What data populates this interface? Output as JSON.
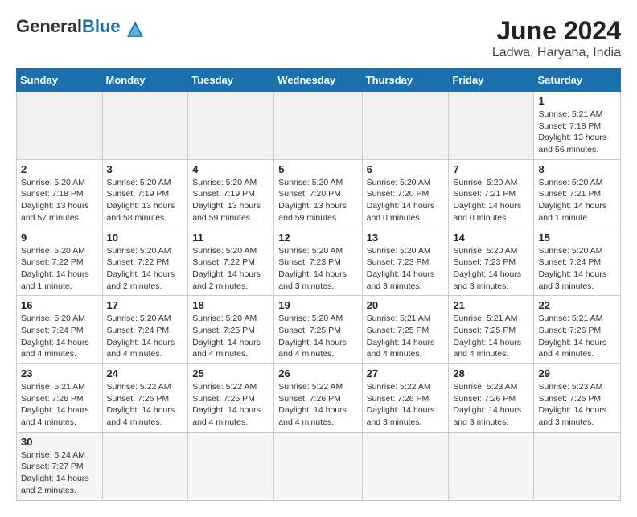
{
  "header": {
    "logo_general": "General",
    "logo_blue": "Blue",
    "month_year": "June 2024",
    "location": "Ladwa, Haryana, India"
  },
  "weekdays": [
    "Sunday",
    "Monday",
    "Tuesday",
    "Wednesday",
    "Thursday",
    "Friday",
    "Saturday"
  ],
  "days": {
    "d1": {
      "num": "1",
      "sunrise": "Sunrise: 5:21 AM",
      "sunset": "Sunset: 7:18 PM",
      "daylight": "Daylight: 13 hours and 56 minutes."
    },
    "d2": {
      "num": "2",
      "sunrise": "Sunrise: 5:20 AM",
      "sunset": "Sunset: 7:18 PM",
      "daylight": "Daylight: 13 hours and 57 minutes."
    },
    "d3": {
      "num": "3",
      "sunrise": "Sunrise: 5:20 AM",
      "sunset": "Sunset: 7:19 PM",
      "daylight": "Daylight: 13 hours and 58 minutes."
    },
    "d4": {
      "num": "4",
      "sunrise": "Sunrise: 5:20 AM",
      "sunset": "Sunset: 7:19 PM",
      "daylight": "Daylight: 13 hours and 59 minutes."
    },
    "d5": {
      "num": "5",
      "sunrise": "Sunrise: 5:20 AM",
      "sunset": "Sunset: 7:20 PM",
      "daylight": "Daylight: 13 hours and 59 minutes."
    },
    "d6": {
      "num": "6",
      "sunrise": "Sunrise: 5:20 AM",
      "sunset": "Sunset: 7:20 PM",
      "daylight": "Daylight: 14 hours and 0 minutes."
    },
    "d7": {
      "num": "7",
      "sunrise": "Sunrise: 5:20 AM",
      "sunset": "Sunset: 7:21 PM",
      "daylight": "Daylight: 14 hours and 0 minutes."
    },
    "d8": {
      "num": "8",
      "sunrise": "Sunrise: 5:20 AM",
      "sunset": "Sunset: 7:21 PM",
      "daylight": "Daylight: 14 hours and 1 minute."
    },
    "d9": {
      "num": "9",
      "sunrise": "Sunrise: 5:20 AM",
      "sunset": "Sunset: 7:22 PM",
      "daylight": "Daylight: 14 hours and 1 minute."
    },
    "d10": {
      "num": "10",
      "sunrise": "Sunrise: 5:20 AM",
      "sunset": "Sunset: 7:22 PM",
      "daylight": "Daylight: 14 hours and 2 minutes."
    },
    "d11": {
      "num": "11",
      "sunrise": "Sunrise: 5:20 AM",
      "sunset": "Sunset: 7:22 PM",
      "daylight": "Daylight: 14 hours and 2 minutes."
    },
    "d12": {
      "num": "12",
      "sunrise": "Sunrise: 5:20 AM",
      "sunset": "Sunset: 7:23 PM",
      "daylight": "Daylight: 14 hours and 3 minutes."
    },
    "d13": {
      "num": "13",
      "sunrise": "Sunrise: 5:20 AM",
      "sunset": "Sunset: 7:23 PM",
      "daylight": "Daylight: 14 hours and 3 minutes."
    },
    "d14": {
      "num": "14",
      "sunrise": "Sunrise: 5:20 AM",
      "sunset": "Sunset: 7:23 PM",
      "daylight": "Daylight: 14 hours and 3 minutes."
    },
    "d15": {
      "num": "15",
      "sunrise": "Sunrise: 5:20 AM",
      "sunset": "Sunset: 7:24 PM",
      "daylight": "Daylight: 14 hours and 3 minutes."
    },
    "d16": {
      "num": "16",
      "sunrise": "Sunrise: 5:20 AM",
      "sunset": "Sunset: 7:24 PM",
      "daylight": "Daylight: 14 hours and 4 minutes."
    },
    "d17": {
      "num": "17",
      "sunrise": "Sunrise: 5:20 AM",
      "sunset": "Sunset: 7:24 PM",
      "daylight": "Daylight: 14 hours and 4 minutes."
    },
    "d18": {
      "num": "18",
      "sunrise": "Sunrise: 5:20 AM",
      "sunset": "Sunset: 7:25 PM",
      "daylight": "Daylight: 14 hours and 4 minutes."
    },
    "d19": {
      "num": "19",
      "sunrise": "Sunrise: 5:20 AM",
      "sunset": "Sunset: 7:25 PM",
      "daylight": "Daylight: 14 hours and 4 minutes."
    },
    "d20": {
      "num": "20",
      "sunrise": "Sunrise: 5:21 AM",
      "sunset": "Sunset: 7:25 PM",
      "daylight": "Daylight: 14 hours and 4 minutes."
    },
    "d21": {
      "num": "21",
      "sunrise": "Sunrise: 5:21 AM",
      "sunset": "Sunset: 7:25 PM",
      "daylight": "Daylight: 14 hours and 4 minutes."
    },
    "d22": {
      "num": "22",
      "sunrise": "Sunrise: 5:21 AM",
      "sunset": "Sunset: 7:26 PM",
      "daylight": "Daylight: 14 hours and 4 minutes."
    },
    "d23": {
      "num": "23",
      "sunrise": "Sunrise: 5:21 AM",
      "sunset": "Sunset: 7:26 PM",
      "daylight": "Daylight: 14 hours and 4 minutes."
    },
    "d24": {
      "num": "24",
      "sunrise": "Sunrise: 5:22 AM",
      "sunset": "Sunset: 7:26 PM",
      "daylight": "Daylight: 14 hours and 4 minutes."
    },
    "d25": {
      "num": "25",
      "sunrise": "Sunrise: 5:22 AM",
      "sunset": "Sunset: 7:26 PM",
      "daylight": "Daylight: 14 hours and 4 minutes."
    },
    "d26": {
      "num": "26",
      "sunrise": "Sunrise: 5:22 AM",
      "sunset": "Sunset: 7:26 PM",
      "daylight": "Daylight: 14 hours and 4 minutes."
    },
    "d27": {
      "num": "27",
      "sunrise": "Sunrise: 5:22 AM",
      "sunset": "Sunset: 7:26 PM",
      "daylight": "Daylight: 14 hours and 3 minutes."
    },
    "d28": {
      "num": "28",
      "sunrise": "Sunrise: 5:23 AM",
      "sunset": "Sunset: 7:26 PM",
      "daylight": "Daylight: 14 hours and 3 minutes."
    },
    "d29": {
      "num": "29",
      "sunrise": "Sunrise: 5:23 AM",
      "sunset": "Sunset: 7:26 PM",
      "daylight": "Daylight: 14 hours and 3 minutes."
    },
    "d30": {
      "num": "30",
      "sunrise": "Sunrise: 5:24 AM",
      "sunset": "Sunset: 7:27 PM",
      "daylight": "Daylight: 14 hours and 2 minutes."
    }
  }
}
